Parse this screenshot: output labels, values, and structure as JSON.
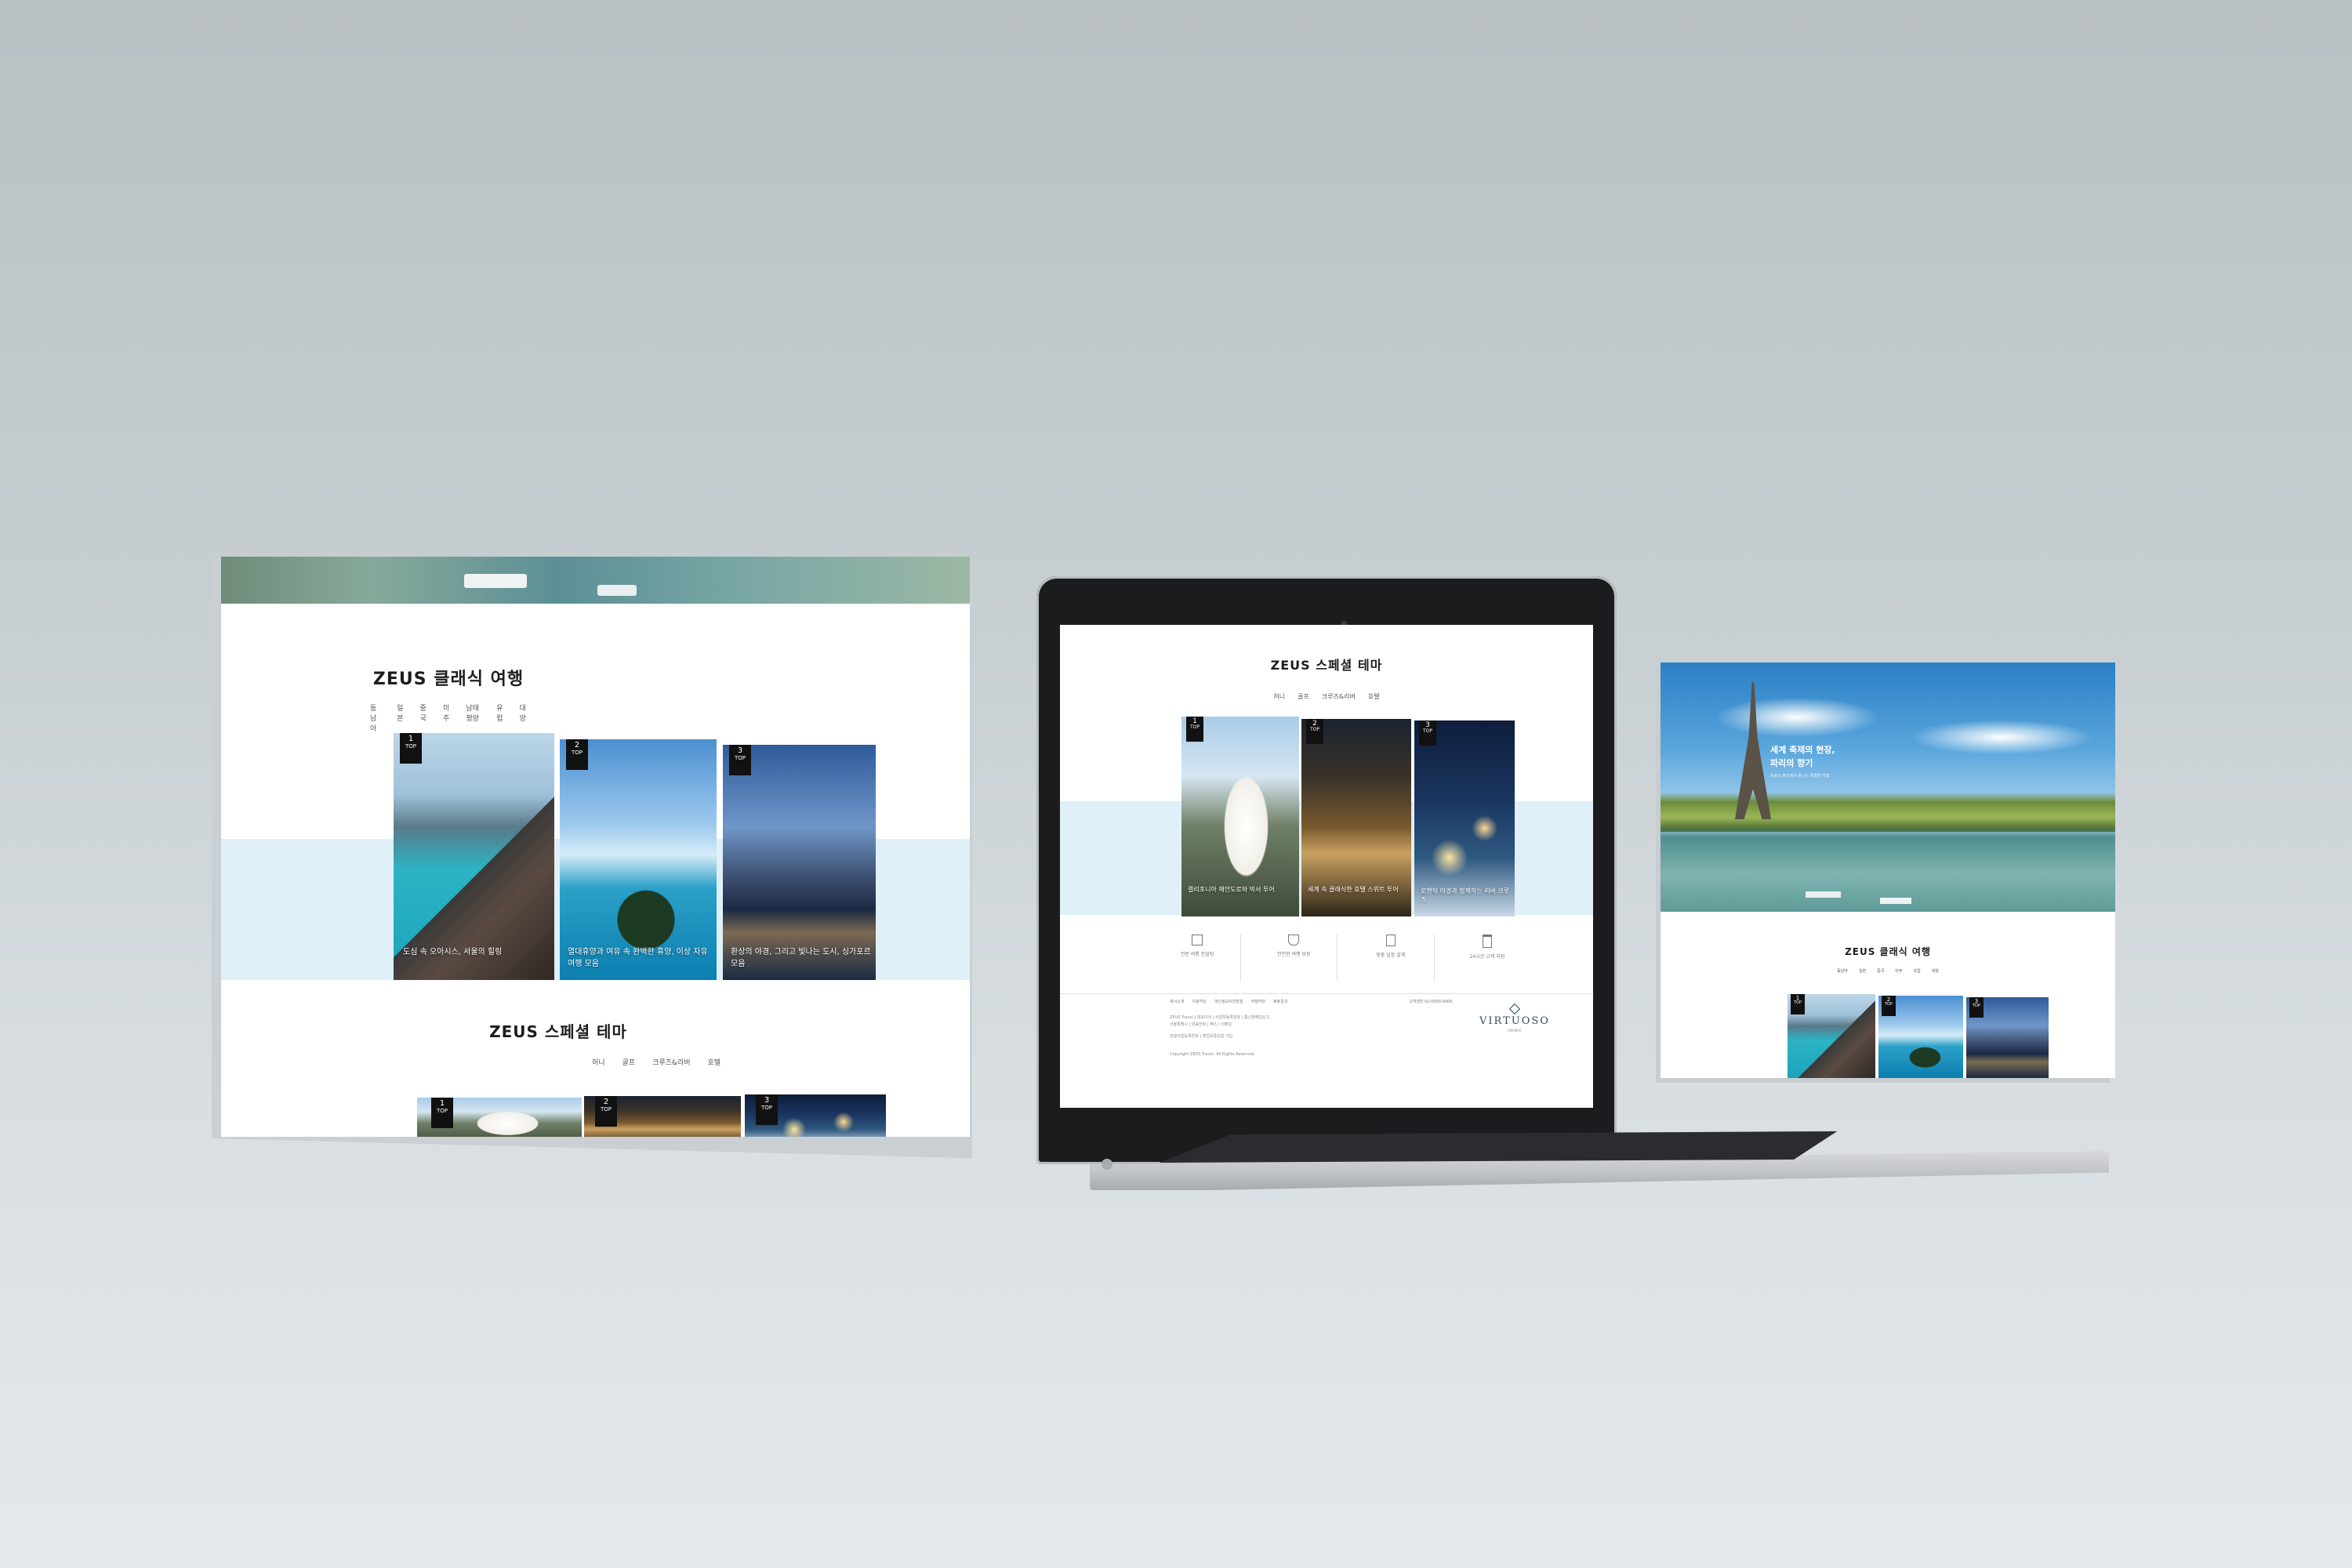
{
  "left_screen": {
    "hero_caption": "",
    "section1_title": "ZEUS 클래식 여행",
    "section1_nav": [
      "동남아",
      "일본",
      "중국",
      "미주",
      "남태평양",
      "유럽",
      "대양"
    ],
    "cards": [
      {
        "rank": "1",
        "top": "TOP",
        "caption": "도심 속 오아시스, 서울의 힐링"
      },
      {
        "rank": "2",
        "top": "TOP",
        "caption": "열대휴양과 여유 속 완벽한 휴양, 이상 자유여행 모음"
      },
      {
        "rank": "3",
        "top": "TOP",
        "caption": "환상의 야경, 그리고 빛나는 도시, 싱가포르 모음"
      }
    ],
    "section2_title": "ZEUS 스페셜 테마",
    "section2_nav": [
      "허니",
      "골프",
      "크루즈&리버",
      "호텔"
    ],
    "cards2": [
      {
        "rank": "1",
        "top": "TOP"
      },
      {
        "rank": "2",
        "top": "TOP"
      },
      {
        "rank": "3",
        "top": "TOP"
      }
    ]
  },
  "laptop_screen": {
    "title": "ZEUS 스페셜 테마",
    "nav": [
      "허니",
      "골프",
      "크루즈&리버",
      "호텔"
    ],
    "cards": [
      {
        "rank": "1",
        "top": "TOP",
        "caption": "캘리포니아 해안도로와 빅서 투어"
      },
      {
        "rank": "2",
        "top": "TOP",
        "caption": "세계 속 클래식한 호텔 스위트 투어"
      },
      {
        "rank": "3",
        "top": "TOP",
        "caption": "로맨틱 야경과 함께하는 리버 크루즈"
      }
    ],
    "features": [
      {
        "icon": "cube-icon",
        "text": "전문 여행 컨설팅"
      },
      {
        "icon": "shield-icon",
        "text": "안전한 여행 보장"
      },
      {
        "icon": "document-icon",
        "text": "맞춤 일정 설계"
      },
      {
        "icon": "clipboard-icon",
        "text": "24시간 고객 지원"
      }
    ],
    "footer_links": [
      "회사소개",
      "이용약관",
      "개인정보처리방침",
      "여행약관",
      "제휴문의"
    ],
    "footer_contact": "고객센터 02-0000-0000",
    "footer_lines": [
      "ZEUS Travel | 대표이사 | 사업자등록번호 | 통신판매업신고",
      "서울특별시 | 대표전화 | 팩스 | 이메일",
      "관광사업등록번호 | 영업보증보험 가입",
      "Copyright ZEUS Travel. All Rights Reserved."
    ],
    "virtuoso": "VIRTUOSO",
    "virtuoso_sub": "MEMBER"
  },
  "right_screen": {
    "hero_heading_line1": "세계 축제의 현장,",
    "hero_heading_line2": "파리의 향기",
    "hero_sub": "프랑스 파리에서 만나는 특별한 여행",
    "section_title": "ZEUS 클래식 여행",
    "nav": [
      "동남아",
      "일본",
      "중국",
      "미주",
      "유럽",
      "대양"
    ],
    "cards": [
      {
        "rank": "1",
        "top": "TOP"
      },
      {
        "rank": "2",
        "top": "TOP"
      },
      {
        "rank": "3",
        "top": "TOP"
      }
    ]
  }
}
